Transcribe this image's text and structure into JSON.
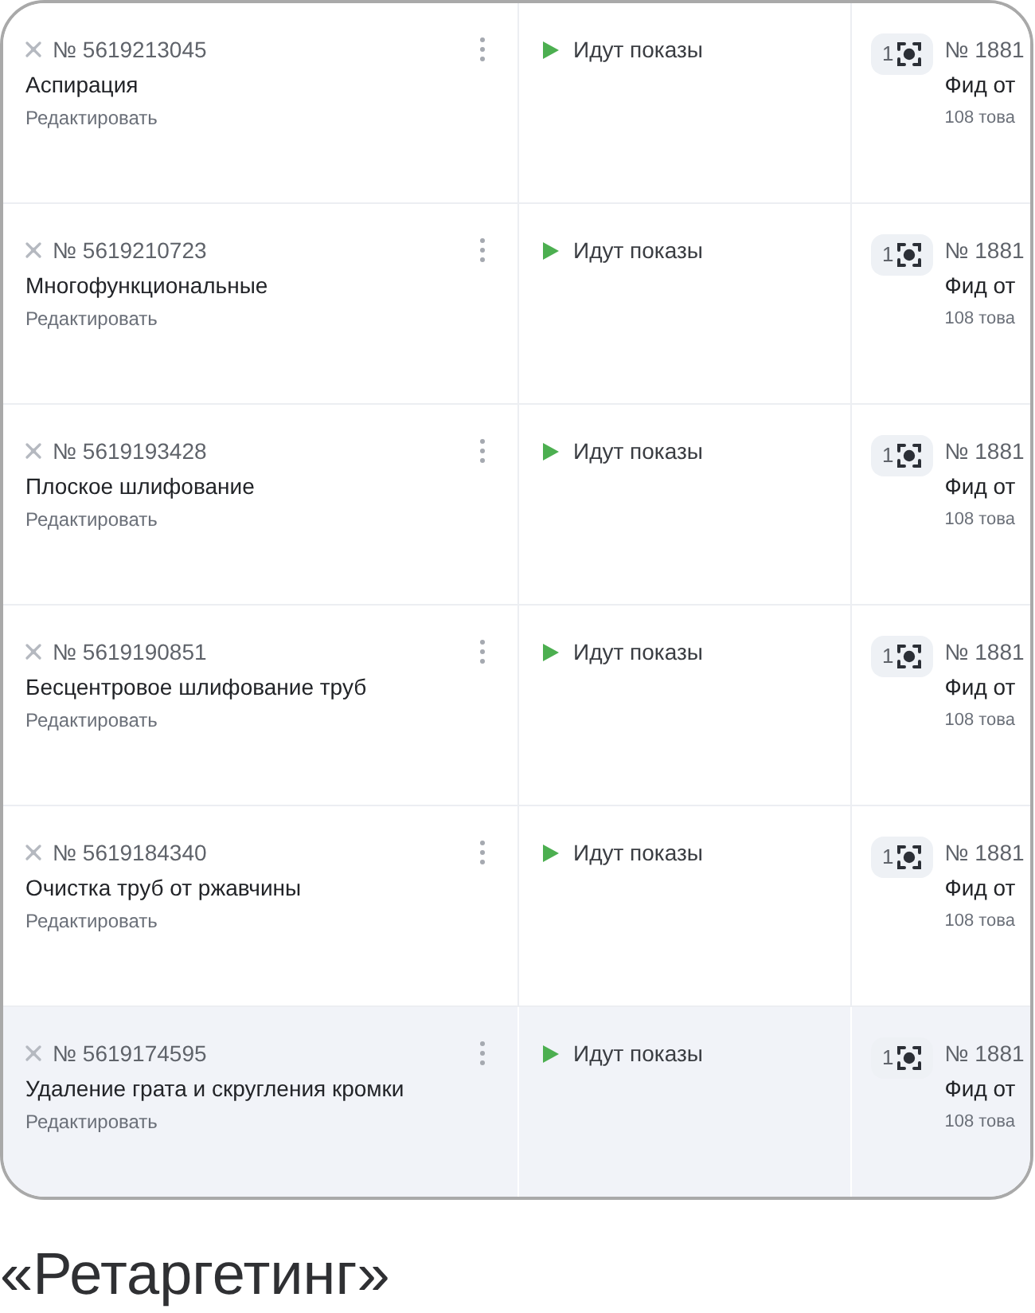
{
  "rows": [
    {
      "number": "№ 5619213045",
      "name": "Аспирация",
      "edit_link": "Редактировать",
      "status": "Идут показы",
      "feed_count": "1",
      "feed_number": "№ 1881",
      "feed_name": "Фид от",
      "feed_items": "108 това",
      "selected": false
    },
    {
      "number": "№ 5619210723",
      "name": "Многофункциональные",
      "edit_link": "Редактировать",
      "status": "Идут показы",
      "feed_count": "1",
      "feed_number": "№ 1881",
      "feed_name": "Фид от",
      "feed_items": "108 това",
      "selected": false
    },
    {
      "number": "№ 5619193428",
      "name": "Плоское шлифование",
      "edit_link": "Редактировать",
      "status": "Идут показы",
      "feed_count": "1",
      "feed_number": "№ 1881",
      "feed_name": "Фид от",
      "feed_items": "108 това",
      "selected": false
    },
    {
      "number": "№ 5619190851",
      "name": "Бесцентровое шлифование труб",
      "edit_link": "Редактировать",
      "status": "Идут показы",
      "feed_count": "1",
      "feed_number": "№ 1881",
      "feed_name": "Фид от",
      "feed_items": "108 това",
      "selected": false
    },
    {
      "number": "№ 5619184340",
      "name": "Очистка труб от ржавчины",
      "edit_link": "Редактировать",
      "status": "Идут показы",
      "feed_count": "1",
      "feed_number": "№ 1881",
      "feed_name": "Фид от",
      "feed_items": "108 това",
      "selected": false
    },
    {
      "number": "№ 5619174595",
      "name": "Удаление грата и скругления кромки",
      "edit_link": "Редактировать",
      "status": "Идут показы",
      "feed_count": "1",
      "feed_number": "№ 1881",
      "feed_name": "Фид от",
      "feed_items": "108 това",
      "selected": true
    }
  ],
  "caption": "«Ретаргетинг»"
}
